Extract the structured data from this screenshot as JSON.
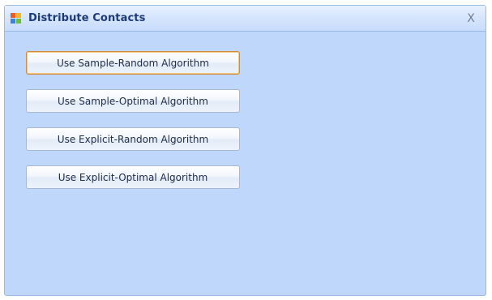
{
  "window": {
    "title": "Distribute Contacts",
    "close_label": "X"
  },
  "buttons": {
    "sample_random": "Use Sample-Random Algorithm",
    "sample_optimal": "Use Sample-Optimal Algorithm",
    "explicit_random": "Use Explicit-Random Algorithm",
    "explicit_optimal": "Use Explicit-Optimal Algorithm"
  },
  "icons": {
    "app": "app-icon",
    "close": "close-icon"
  },
  "colors": {
    "window_background": "#bfd7fb",
    "title_text": "#1e3b78",
    "focused_border": "#d38a3a"
  }
}
